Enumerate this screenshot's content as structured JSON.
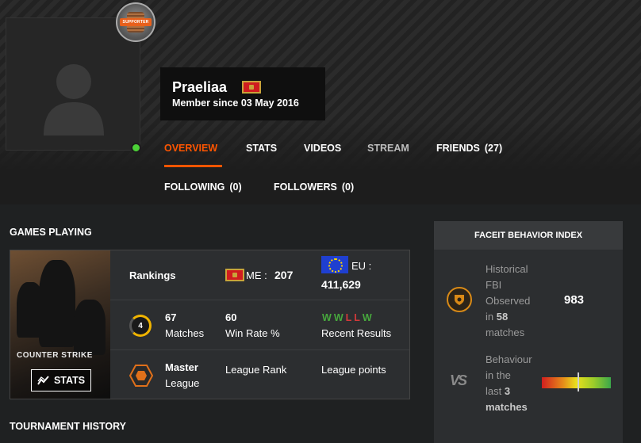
{
  "profile": {
    "username": "Praeliaa",
    "member_since": "Member since 03 May 2016",
    "country_flag": "montenegro-flag",
    "status_color": "#4cd137",
    "supporter_badge": "SUPPORTER"
  },
  "nav": {
    "overview": "OVERVIEW",
    "stats": "STATS",
    "videos": "VIDEOS",
    "stream": "STREAM",
    "friends": "FRIENDS",
    "friends_count": "(27)",
    "following": "FOLLOWING",
    "following_count": "(0)",
    "followers": "FOLLOWERS",
    "followers_count": "(0)"
  },
  "games": {
    "section_title": "GAMES PLAYING",
    "game_logo": "COUNTER STRIKE",
    "stats_button": "STATS",
    "rankings_label": "Rankings",
    "region_me": "ME :",
    "region_me_rank": "207",
    "region_eu": "EU :",
    "region_eu_rank": "411,629",
    "skill_level": "4",
    "matches_value": "67",
    "matches_label": "Matches",
    "winrate_value": "60",
    "winrate_label": "Win Rate %",
    "recent_results": [
      "W",
      "W",
      "L",
      "L",
      "W"
    ],
    "recent_results_label": "Recent Results",
    "league_value": "Master",
    "league_label": "League",
    "league_rank_label": "League Rank",
    "league_points_label": "League points"
  },
  "tournament": {
    "section_title": "TOURNAMENT HISTORY"
  },
  "fbi": {
    "title": "FACEIT BEHAVIOR INDEX",
    "historical_line1": "Historical",
    "historical_line2": "FBI",
    "historical_line3": "Observed",
    "historical_line4_prefix": "in",
    "historical_matches": "58",
    "historical_line5": "matches",
    "score": "983",
    "behaviour_line1": "Behaviour",
    "behaviour_line2": "in the",
    "behaviour_line3_prefix": "last",
    "behaviour_matches": "3",
    "behaviour_line4": "matches",
    "behaviour_level": 0.53
  },
  "colors": {
    "accent": "#ff5500",
    "win": "#47a83d",
    "loss": "#d23a3a",
    "panel": "#2c2e30"
  }
}
